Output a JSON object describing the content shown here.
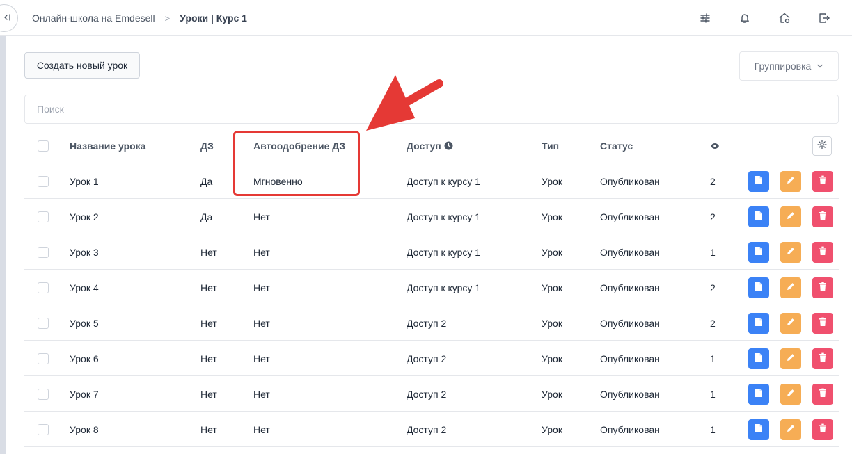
{
  "breadcrumb": {
    "school": "Онлайн-школа на Emdesell",
    "separator": ">",
    "current": "Уроки | Курс 1"
  },
  "toolbar": {
    "create_label": "Создать новый урок",
    "group_label": "Группировка",
    "search_placeholder": "Поиск"
  },
  "table": {
    "columns": {
      "name": "Название урока",
      "homework": "ДЗ",
      "auto_approve": "Автоодобрение ДЗ",
      "access": "Доступ",
      "type": "Тип",
      "status": "Статус"
    },
    "rows": [
      {
        "name": "Урок 1",
        "homework": "Да",
        "auto_approve": "Мгновенно",
        "access": "Доступ к курсу 1",
        "type": "Урок",
        "status": "Опубликован",
        "views": "2"
      },
      {
        "name": "Урок 2",
        "homework": "Да",
        "auto_approve": "Нет",
        "access": "Доступ к курсу 1",
        "type": "Урок",
        "status": "Опубликован",
        "views": "2"
      },
      {
        "name": "Урок 3",
        "homework": "Нет",
        "auto_approve": "Нет",
        "access": "Доступ к курсу 1",
        "type": "Урок",
        "status": "Опубликован",
        "views": "1"
      },
      {
        "name": "Урок 4",
        "homework": "Нет",
        "auto_approve": "Нет",
        "access": "Доступ к курсу 1",
        "type": "Урок",
        "status": "Опубликован",
        "views": "2"
      },
      {
        "name": "Урок 5",
        "homework": "Нет",
        "auto_approve": "Нет",
        "access": "Доступ 2",
        "type": "Урок",
        "status": "Опубликован",
        "views": "2"
      },
      {
        "name": "Урок 6",
        "homework": "Нет",
        "auto_approve": "Нет",
        "access": "Доступ 2",
        "type": "Урок",
        "status": "Опубликован",
        "views": "1"
      },
      {
        "name": "Урок 7",
        "homework": "Нет",
        "auto_approve": "Нет",
        "access": "Доступ 2",
        "type": "Урок",
        "status": "Опубликован",
        "views": "1"
      },
      {
        "name": "Урок 8",
        "homework": "Нет",
        "auto_approve": "Нет",
        "access": "Доступ 2",
        "type": "Урок",
        "status": "Опубликован",
        "views": "1"
      }
    ]
  },
  "icons": {
    "collapse": "collapse-sidebar-icon",
    "filters": "sliders-icon",
    "notifications": "bell-icon",
    "home_settings": "home-gear-icon",
    "logout": "logout-icon",
    "access_info": "clock-icon",
    "views": "eye-icon",
    "columns_settings": "gear-icon",
    "view_action": "document-icon",
    "edit_action": "pencil-icon",
    "delete_action": "trash-icon"
  },
  "colors": {
    "view_button": "#3b82f6",
    "edit_button": "#f6ad55",
    "delete_button": "#f0506e",
    "annotation": "#e53935"
  }
}
